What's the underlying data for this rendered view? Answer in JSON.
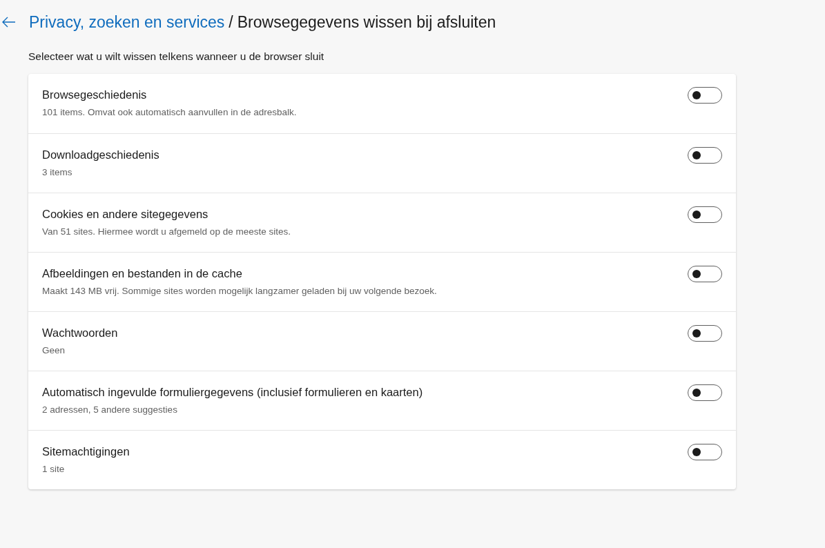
{
  "header": {
    "parent_link": "Privacy, zoeken en services",
    "separator": "/",
    "title": "Browsegegevens wissen bij afsluiten"
  },
  "subtitle": "Selecteer wat u wilt wissen telkens wanneer u de browser sluit",
  "items": [
    {
      "title": "Browsegeschiedenis",
      "description": "101 items. Omvat ook automatisch aanvullen in de adresbalk.",
      "on": false
    },
    {
      "title": "Downloadgeschiedenis",
      "description": "3 items",
      "on": false
    },
    {
      "title": "Cookies en andere sitegegevens",
      "description": "Van 51 sites. Hiermee wordt u afgemeld op de meeste sites.",
      "on": false
    },
    {
      "title": "Afbeeldingen en bestanden in de cache",
      "description": "Maakt 143 MB vrij. Sommige sites worden mogelijk langzamer geladen bij uw volgende bezoek.",
      "on": false
    },
    {
      "title": "Wachtwoorden",
      "description": "Geen",
      "on": false
    },
    {
      "title": "Automatisch ingevulde formuliergegevens (inclusief formulieren en kaarten)",
      "description": "2 adressen, 5 andere suggesties",
      "on": false
    },
    {
      "title": "Sitemachtigingen",
      "description": "1 site",
      "on": false
    }
  ]
}
